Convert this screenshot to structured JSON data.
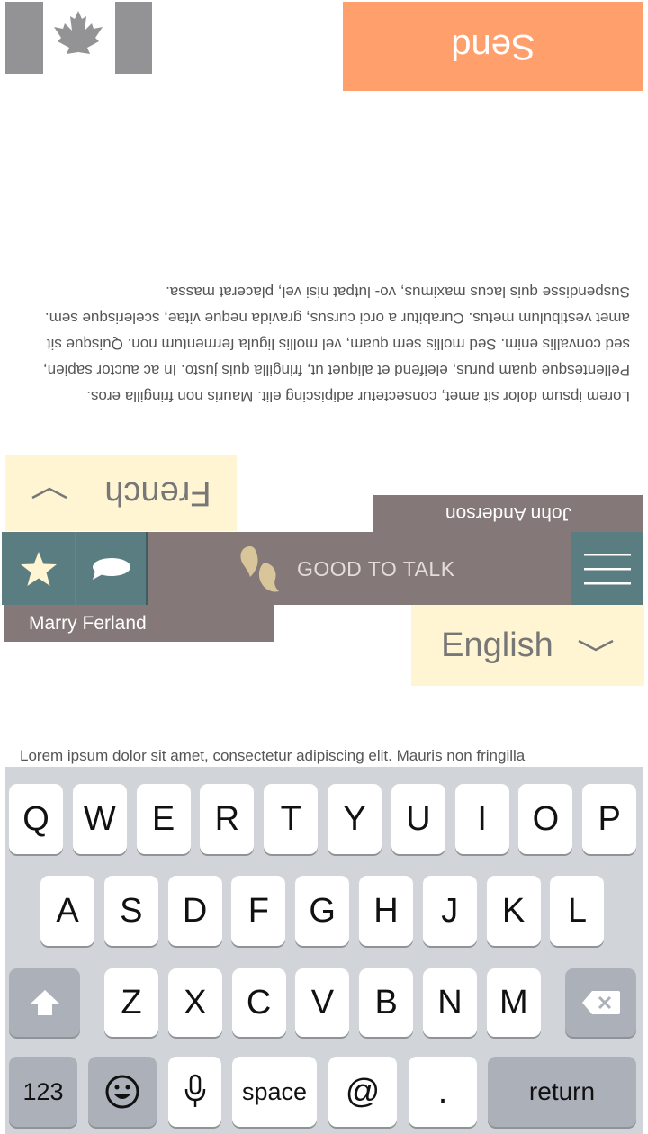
{
  "top": {
    "send_label": "Send",
    "message": "Lorem ipsum dolor sit amet, consectetur adipiscing elit. Mauris non fringilla eros. Pellentesque quam purus, eleifend et aliquet ut, fringilla quis justo. In ac auctor sapien, sed convallis enim. Sed mollis sem quam, vel mollis ligula fermentum non. Quisque sit amet vestibulum metus. Curabitur a orci cursus, gravida neque vitae, scelerisque sem. Suspendisse quis lacus maximus, vo- lutpat nisi vel, placerat massa.",
    "language": "French",
    "user_name": "John Anderson",
    "flag_icon": "canada-flag-icon"
  },
  "navbar": {
    "brand": "GOOD TO TALK",
    "icons": [
      "star-icon",
      "chat-bubble-icon",
      "quote-logo-icon",
      "menu-icon"
    ],
    "colors": {
      "bar": "#857878",
      "tile": "#5a7d82",
      "send": "#ff9f6b",
      "lang": "#fff5d2"
    }
  },
  "bottom": {
    "user_name": "Marry Ferland",
    "language": "English",
    "message": "Lorem ipsum dolor sit amet, consectetur adipiscing elit. Mauris non fringilla"
  },
  "keyboard": {
    "row1": [
      "Q",
      "W",
      "E",
      "R",
      "T",
      "Y",
      "U",
      "I",
      "O",
      "P"
    ],
    "row2": [
      "A",
      "S",
      "D",
      "F",
      "G",
      "H",
      "J",
      "K",
      "L"
    ],
    "row3": [
      "Z",
      "X",
      "C",
      "V",
      "B",
      "N",
      "M"
    ],
    "numbers_label": "123",
    "space_label": "space",
    "at_label": "@",
    "period_label": ".",
    "return_label": "return"
  }
}
